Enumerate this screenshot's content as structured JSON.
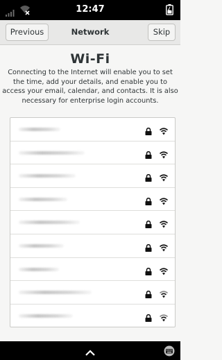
{
  "statusbar": {
    "time": "12:47",
    "icons": [
      "signal-bars-icon",
      "wifi-disconnected-icon",
      "battery-icon"
    ]
  },
  "header": {
    "previous_label": "Previous",
    "title": "Network",
    "skip_label": "Skip"
  },
  "page": {
    "title": "Wi-Fi",
    "description": "Connecting to the Internet will enable you to set the time, add your details, and enable you to access your email, calendar, and contacts. It is also necessary for enterprise login accounts."
  },
  "networks": [
    {
      "ssid": "",
      "secured": true,
      "signal_icon": "wifi-full-icon"
    },
    {
      "ssid": "",
      "secured": true,
      "signal_icon": "wifi-full-icon"
    },
    {
      "ssid": "",
      "secured": true,
      "signal_icon": "wifi-full-icon"
    },
    {
      "ssid": "",
      "secured": true,
      "signal_icon": "wifi-full-icon"
    },
    {
      "ssid": "",
      "secured": true,
      "signal_icon": "wifi-full-icon"
    },
    {
      "ssid": "",
      "secured": true,
      "signal_icon": "wifi-full-icon"
    },
    {
      "ssid": "",
      "secured": true,
      "signal_icon": "wifi-full-icon"
    },
    {
      "ssid": "",
      "secured": true,
      "signal_icon": "wifi-medium-icon"
    },
    {
      "ssid": "",
      "secured": true,
      "signal_icon": "wifi-medium-icon"
    }
  ],
  "bottombar": {
    "icons": [
      "chevron-up-icon",
      "keyboard-icon"
    ]
  },
  "colors": {
    "background": "#f6f6f5",
    "panel_bars": "#000000",
    "headerbar": "#e8e8e7",
    "list_bg": "#ffffff"
  }
}
